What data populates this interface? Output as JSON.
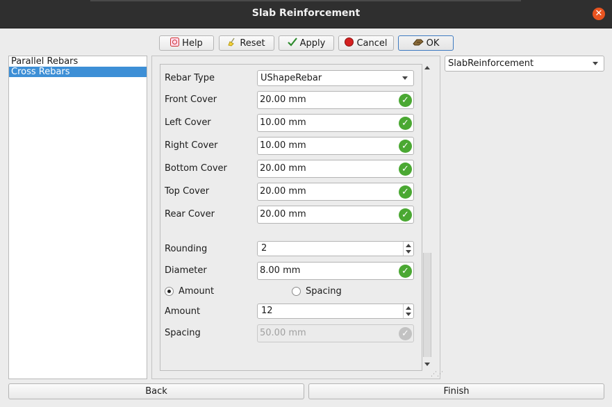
{
  "window": {
    "title": "Slab Reinforcement",
    "close_icon": "close-icon"
  },
  "toolbar": {
    "help": "Help",
    "reset": "Reset",
    "apply": "Apply",
    "cancel": "Cancel",
    "ok": "OK"
  },
  "sidebar": {
    "items": [
      {
        "label": "Parallel Rebars"
      },
      {
        "label": "Cross Rebars"
      }
    ]
  },
  "object_selector": {
    "value": "SlabReinforcement"
  },
  "form": {
    "rebar_type": {
      "label": "Rebar Type",
      "value": "UShapeRebar"
    },
    "front_cover": {
      "label": "Front Cover",
      "value": "20.00 mm"
    },
    "left_cover": {
      "label": "Left Cover",
      "value": "10.00 mm"
    },
    "right_cover": {
      "label": "Right Cover",
      "value": "10.00 mm"
    },
    "bottom_cover": {
      "label": "Bottom Cover",
      "value": "20.00 mm"
    },
    "top_cover": {
      "label": "Top Cover",
      "value": "20.00 mm"
    },
    "rear_cover": {
      "label": "Rear Cover",
      "value": "20.00 mm"
    },
    "rounding": {
      "label": "Rounding",
      "value": "2"
    },
    "diameter": {
      "label": "Diameter",
      "value": "8.00 mm"
    },
    "mode": {
      "amount_label": "Amount",
      "spacing_label": "Spacing",
      "selected": "Amount"
    },
    "amount": {
      "label": "Amount",
      "value": "12"
    },
    "spacing": {
      "label": "Spacing",
      "value": "50.00 mm"
    }
  },
  "footer": {
    "back": "Back",
    "finish": "Finish"
  },
  "colors": {
    "accent": "#3d8fd6",
    "valid": "#4aa832",
    "close": "#e95420"
  }
}
